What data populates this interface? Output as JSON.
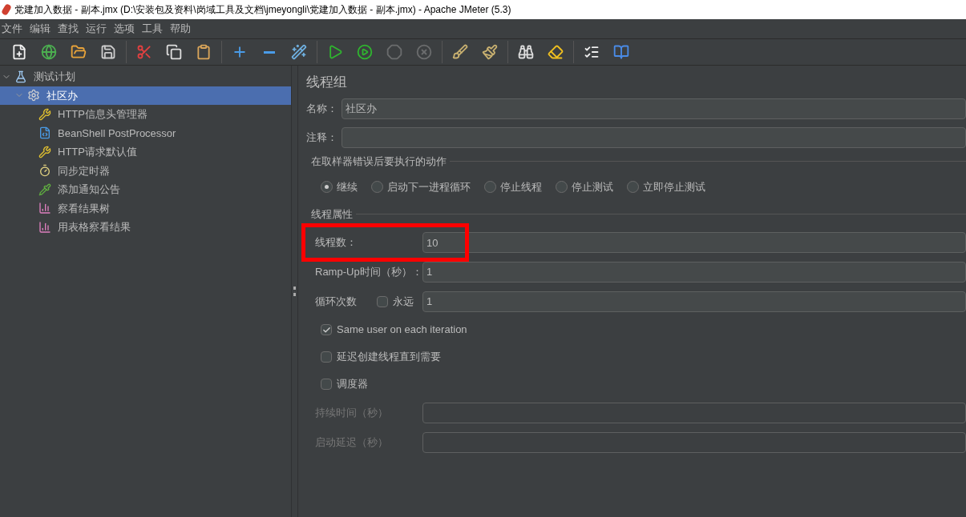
{
  "window": {
    "title": "党建加入数据 - 副本.jmx (D:\\安装包及资料\\岗域工具及文档\\jmeyongli\\党建加入数据 - 副本.jmx) - Apache JMeter (5.3)"
  },
  "menu": [
    "文件",
    "编辑",
    "查找",
    "运行",
    "选项",
    "工具",
    "帮助"
  ],
  "toolbar": [
    [
      {
        "kind": "new",
        "disabled": false
      },
      {
        "kind": "templates",
        "disabled": false
      },
      {
        "kind": "open",
        "disabled": false
      },
      {
        "kind": "save",
        "disabled": false
      }
    ],
    [
      {
        "kind": "cut",
        "disabled": false
      },
      {
        "kind": "copy",
        "disabled": false
      },
      {
        "kind": "paste",
        "disabled": false
      }
    ],
    [
      {
        "kind": "expand",
        "disabled": false
      },
      {
        "kind": "collapse",
        "disabled": false
      },
      {
        "kind": "toggle",
        "disabled": false
      }
    ],
    [
      {
        "kind": "start",
        "disabled": false
      },
      {
        "kind": "start_no_pause",
        "disabled": false
      },
      {
        "kind": "stop",
        "disabled": true
      },
      {
        "kind": "shutdown",
        "disabled": true
      }
    ],
    [
      {
        "kind": "clear",
        "disabled": false
      },
      {
        "kind": "clear_all",
        "disabled": false
      }
    ],
    [
      {
        "kind": "search",
        "disabled": false
      },
      {
        "kind": "reset_search",
        "disabled": false
      }
    ],
    [
      {
        "kind": "functions",
        "disabled": false
      },
      {
        "kind": "help",
        "disabled": false
      }
    ]
  ],
  "tree": [
    {
      "label": "测试计划",
      "kind": "plan",
      "expanded": true,
      "selected": false,
      "children": [
        {
          "label": "社区办",
          "kind": "thread_group",
          "expanded": true,
          "selected": true,
          "children": [
            {
              "label": "HTTP信息头管理器",
              "kind": "config",
              "selected": false
            },
            {
              "label": "BeanShell PostProcessor",
              "kind": "script",
              "selected": false
            },
            {
              "label": "HTTP请求默认值",
              "kind": "config",
              "selected": false
            },
            {
              "label": "同步定时器",
              "kind": "timer",
              "selected": false
            },
            {
              "label": "添加通知公告",
              "kind": "sampler",
              "selected": false
            },
            {
              "label": "察看结果树",
              "kind": "listener",
              "selected": false
            },
            {
              "label": "用表格察看结果",
              "kind": "listener",
              "selected": false
            }
          ]
        }
      ]
    }
  ],
  "panel": {
    "title": "线程组",
    "name": {
      "label": "名称：",
      "value": "社区办"
    },
    "comment": {
      "label": "注释："
    },
    "on_error": {
      "title": "在取样器错误后要执行的动作",
      "options": [
        {
          "label": "继续",
          "selected": true
        },
        {
          "label": "启动下一进程循环",
          "selected": false
        },
        {
          "label": "停止线程",
          "selected": false
        },
        {
          "label": "停止测试",
          "selected": false
        },
        {
          "label": "立即停止测试",
          "selected": false
        }
      ]
    },
    "thread_props": {
      "title": "线程属性",
      "threads": {
        "label": "线程数：",
        "value": "10",
        "highlighted": true
      },
      "ramp_up": {
        "label": "Ramp-Up时间（秒）：",
        "value": "1"
      },
      "loops": {
        "label": "循环次数",
        "forever": {
          "label": "永远",
          "checked": false
        },
        "value": "1"
      },
      "checkboxes": [
        {
          "label": "Same user on each iteration",
          "checked": true
        },
        {
          "label": "延迟创建线程直到需要",
          "checked": false
        },
        {
          "label": "调度器",
          "checked": false
        }
      ],
      "duration": {
        "label": "持续时间（秒）",
        "disabled": true
      },
      "startup_delay": {
        "label": "启动延迟（秒）",
        "disabled": true
      }
    }
  }
}
